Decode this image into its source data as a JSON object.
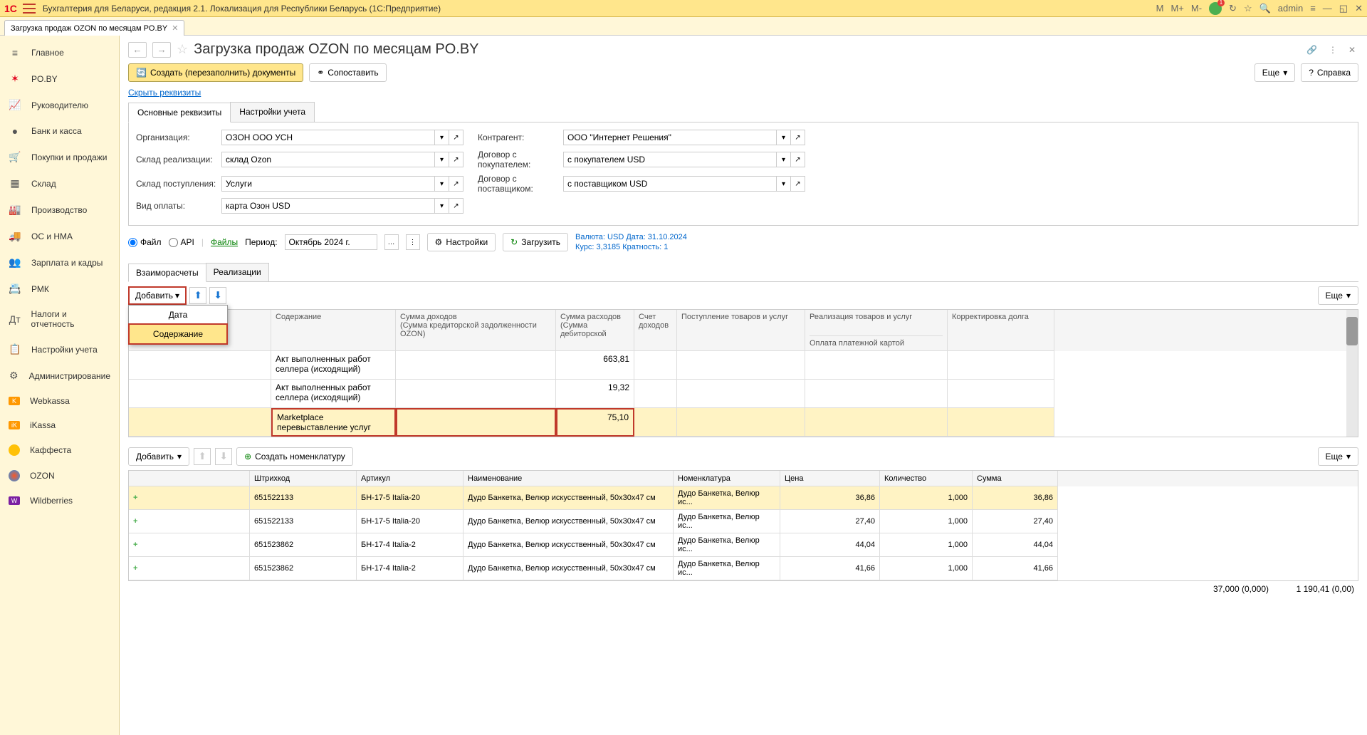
{
  "titlebar": {
    "app_title": "Бухгалтерия для Беларуси, редакция 2.1. Локализация для Республики Беларусь  (1С:Предприятие)",
    "logo": "1C",
    "m": "M",
    "m_plus": "M+",
    "m_minus": "M-",
    "admin": "admin"
  },
  "tab": {
    "title": "Загрузка продаж OZON по месяцам PO.BY"
  },
  "sidebar": {
    "items": [
      {
        "label": "Главное"
      },
      {
        "label": "PO.BY"
      },
      {
        "label": "Руководителю"
      },
      {
        "label": "Банк и касса"
      },
      {
        "label": "Покупки и продажи"
      },
      {
        "label": "Склад"
      },
      {
        "label": "Производство"
      },
      {
        "label": "ОС и НМА"
      },
      {
        "label": "Зарплата и кадры"
      },
      {
        "label": "РМК"
      },
      {
        "label": "Налоги и отчетность"
      },
      {
        "label": "Настройки учета"
      },
      {
        "label": "Администрирование"
      },
      {
        "label": "Webkassa"
      },
      {
        "label": "iKassa"
      },
      {
        "label": "Каффеста"
      },
      {
        "label": "OZON"
      },
      {
        "label": "Wildberries"
      }
    ]
  },
  "page": {
    "title": "Загрузка продаж OZON по месяцам PO.BY",
    "create_btn": "Создать (перезаполнить) документы",
    "compare_btn": "Сопоставить",
    "more_btn": "Еще",
    "help_btn": "Справка",
    "hide_link": "Скрыть реквизиты"
  },
  "form_tabs": {
    "main": "Основные реквизиты",
    "settings": "Настройки учета"
  },
  "form": {
    "org_label": "Организация:",
    "org_value": "ОЗОН ООО УСН",
    "sklad_real_label": "Склад реализации:",
    "sklad_real_value": "склад Ozon",
    "sklad_post_label": "Склад поступления:",
    "sklad_post_value": "Услуги",
    "pay_label": "Вид оплаты:",
    "pay_value": "карта Озон USD",
    "contr_label": "Контрагент:",
    "contr_value": "ООО \"Интернет Решения\"",
    "dog_buy_label": "Договор с покупателем:",
    "dog_buy_value": "с покупателем USD",
    "dog_sup_label": "Договор с поставщиком:",
    "dog_sup_value": "с поставщиком USD"
  },
  "source": {
    "file": "Файл",
    "api": "API",
    "files_link": "Файлы",
    "period_label": "Период:",
    "period_value": "Октябрь 2024 г.",
    "settings_btn": "Настройки",
    "load_btn": "Загрузить",
    "info1": "Валюта: USD Дата: 31.10.2024",
    "info2": "Курс: 3,3185 Кратность: 1"
  },
  "sub_tabs": {
    "vzaim": "Взаиморасчеты",
    "real": "Реализации"
  },
  "grid": {
    "add_btn": "Добавить",
    "menu": {
      "date": "Дата",
      "content": "Содержание"
    },
    "more_btn": "Еще",
    "headers": {
      "content": "Содержание",
      "income": "Сумма доходов",
      "income_sub": "(Сумма кредиторской задолженности OZON)",
      "expense": "Сумма расходов",
      "expense_sub": "(Сумма дебиторской",
      "acct": "Счет доходов",
      "in": "Поступление товаров и услуг",
      "out": "Реализация товаров и услуг",
      "out_sub": "Оплата платежной картой",
      "corr": "Корректировка долга"
    },
    "rows": [
      {
        "content": "Акт выполненных работ селлера (исходящий)",
        "expense": "663,81"
      },
      {
        "content": "Акт выполненных работ селлера (исходящий)",
        "expense": "19,32"
      },
      {
        "content": "Marketplace перевыставление услуг",
        "expense": "75,10"
      }
    ]
  },
  "bottom": {
    "add_btn": "Добавить",
    "create_nom": "Создать номенклатуру",
    "more_btn": "Еще",
    "headers": {
      "barcode": "Штрихкод",
      "article": "Артикул",
      "name": "Наименование",
      "nom": "Номенклатура",
      "price": "Цена",
      "qty": "Количество",
      "sum": "Сумма"
    },
    "rows": [
      {
        "barcode": "651522133",
        "article": "БН-17-5 Italia-20",
        "name": "Дудо Банкетка, Велюр искусственный, 50х30х47 см",
        "nom": "Дудо Банкетка, Велюр ис...",
        "price": "36,86",
        "qty": "1,000",
        "sum": "36,86"
      },
      {
        "barcode": "651522133",
        "article": "БН-17-5 Italia-20",
        "name": "Дудо Банкетка, Велюр искусственный, 50х30х47 см",
        "nom": "Дудо Банкетка, Велюр ис...",
        "price": "27,40",
        "qty": "1,000",
        "sum": "27,40"
      },
      {
        "barcode": "651523862",
        "article": "БН-17-4 Italia-2",
        "name": "Дудо Банкетка, Велюр искусственный, 50х30х47 см",
        "nom": "Дудо Банкетка, Велюр ис...",
        "price": "44,04",
        "qty": "1,000",
        "sum": "44,04"
      },
      {
        "barcode": "651523862",
        "article": "БН-17-4 Italia-2",
        "name": "Дудо Банкетка, Велюр искусственный, 50х30х47 см",
        "nom": "Дудо Банкетка, Велюр ис...",
        "price": "41,66",
        "qty": "1,000",
        "sum": "41,66"
      }
    ],
    "footer": {
      "qty": "37,000 (0,000)",
      "sum": "1 190,41 (0,00)"
    }
  }
}
